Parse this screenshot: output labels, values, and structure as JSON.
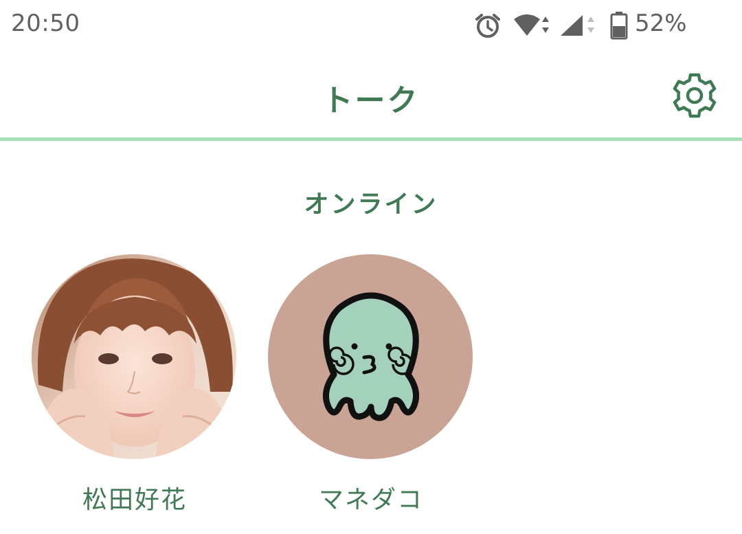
{
  "status_bar": {
    "time": "20:50",
    "battery_percent": "52%",
    "icons": [
      "alarm-icon",
      "wifi-icon",
      "cell-signal-icon",
      "battery-icon"
    ]
  },
  "header": {
    "title": "トーク",
    "settings_icon": "gear-icon"
  },
  "online": {
    "section_title": "オンライン",
    "users": [
      {
        "name": "松田好花",
        "avatar": "photo"
      },
      {
        "name": "マネダコ",
        "avatar": "octopus-illustration"
      }
    ]
  },
  "colors": {
    "accent": "#3f7a54",
    "divider": "#a8e0b8",
    "octopus_bg": "#c9a494",
    "octopus_body": "#a3d1bc"
  }
}
